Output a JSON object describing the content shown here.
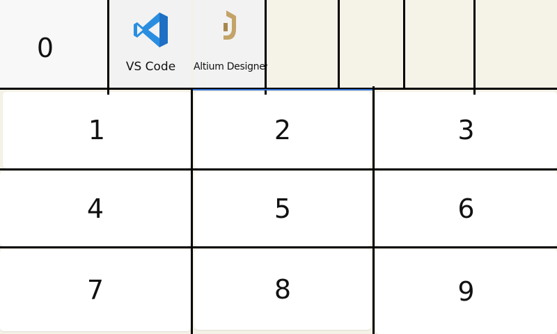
{
  "top_row": {
    "zero_key": "0",
    "apps": [
      {
        "label": "VS Code",
        "icon": "vscode-icon",
        "color": "#1f8ad2"
      },
      {
        "label": "Altium Designer",
        "icon": "altium-designer-icon",
        "color": "#b8985a"
      }
    ]
  },
  "keypad": {
    "keys": [
      "1",
      "2",
      "3",
      "4",
      "5",
      "6",
      "7",
      "8",
      "9"
    ]
  },
  "colors": {
    "background": "#f4f1e6",
    "key_background": "#ffffff",
    "grid_line": "#000000",
    "focus_accent": "#2f6fd6"
  }
}
